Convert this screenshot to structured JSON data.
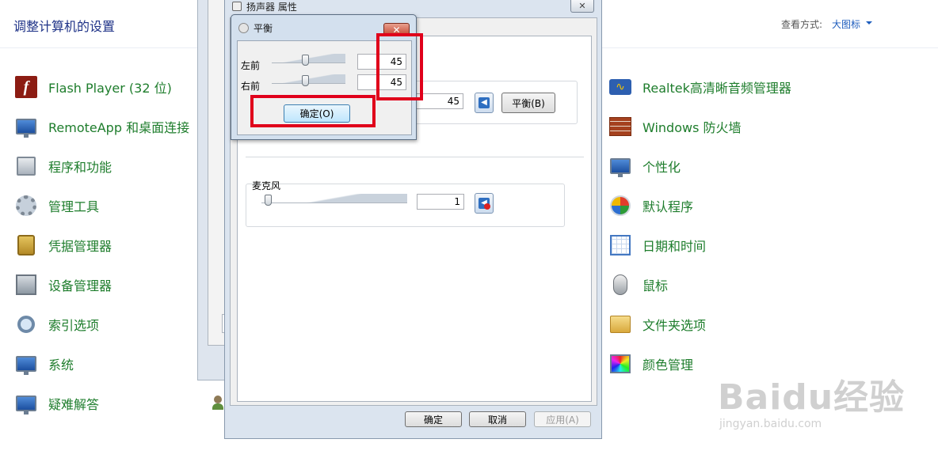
{
  "control_panel": {
    "title": "调整计算机的设置",
    "view_by_label": "查看方式:",
    "view_mode": "大图标",
    "left_items": [
      {
        "label": "Flash Player (32 位)",
        "icon": "flash-player-icon"
      },
      {
        "label": "RemoteApp 和桌面连接",
        "icon": "remoteapp-icon"
      },
      {
        "label": "程序和功能",
        "icon": "programs-features-icon"
      },
      {
        "label": "管理工具",
        "icon": "admin-tools-icon"
      },
      {
        "label": "凭据管理器",
        "icon": "credential-manager-icon"
      },
      {
        "label": "设备管理器",
        "icon": "device-manager-icon"
      },
      {
        "label": "索引选项",
        "icon": "indexing-options-icon"
      },
      {
        "label": "系统",
        "icon": "system-icon"
      },
      {
        "label": "疑难解答",
        "icon": "troubleshooting-icon"
      }
    ],
    "right_items": [
      {
        "label": "Realtek高清晰音频管理器",
        "icon": "realtek-audio-icon"
      },
      {
        "label": "Windows 防火墙",
        "icon": "firewall-icon"
      },
      {
        "label": "个性化",
        "icon": "personalization-icon"
      },
      {
        "label": "默认程序",
        "icon": "default-programs-icon"
      },
      {
        "label": "日期和时间",
        "icon": "date-time-icon"
      },
      {
        "label": "鼠标",
        "icon": "mouse-icon"
      },
      {
        "label": "文件夹选项",
        "icon": "folder-options-icon"
      },
      {
        "label": "颜色管理",
        "icon": "color-management-icon"
      }
    ]
  },
  "speaker_properties": {
    "title": "扬声器 属性",
    "close_glyph": "✕",
    "speaker_level": "45",
    "balance_button": "平衡(B)",
    "microphone": {
      "label": "麦克风",
      "level": "1",
      "muted": true
    },
    "buttons": {
      "ok": "确定",
      "cancel": "取消",
      "apply": "应用(A)"
    }
  },
  "balance_dialog": {
    "title": "平衡",
    "close_glyph": "✕",
    "channels": [
      {
        "label": "左前",
        "value": "45",
        "level_percent": 45
      },
      {
        "label": "右前",
        "value": "45",
        "level_percent": 45
      }
    ],
    "ok_button": "确定(O)"
  },
  "watermark": {
    "text": "Baidu经验",
    "url": "jingyan.baidu.com"
  },
  "colors": {
    "link_green": "#1e7d2c",
    "title_blue": "#1e3287",
    "highlight_red": "#e0001b"
  }
}
